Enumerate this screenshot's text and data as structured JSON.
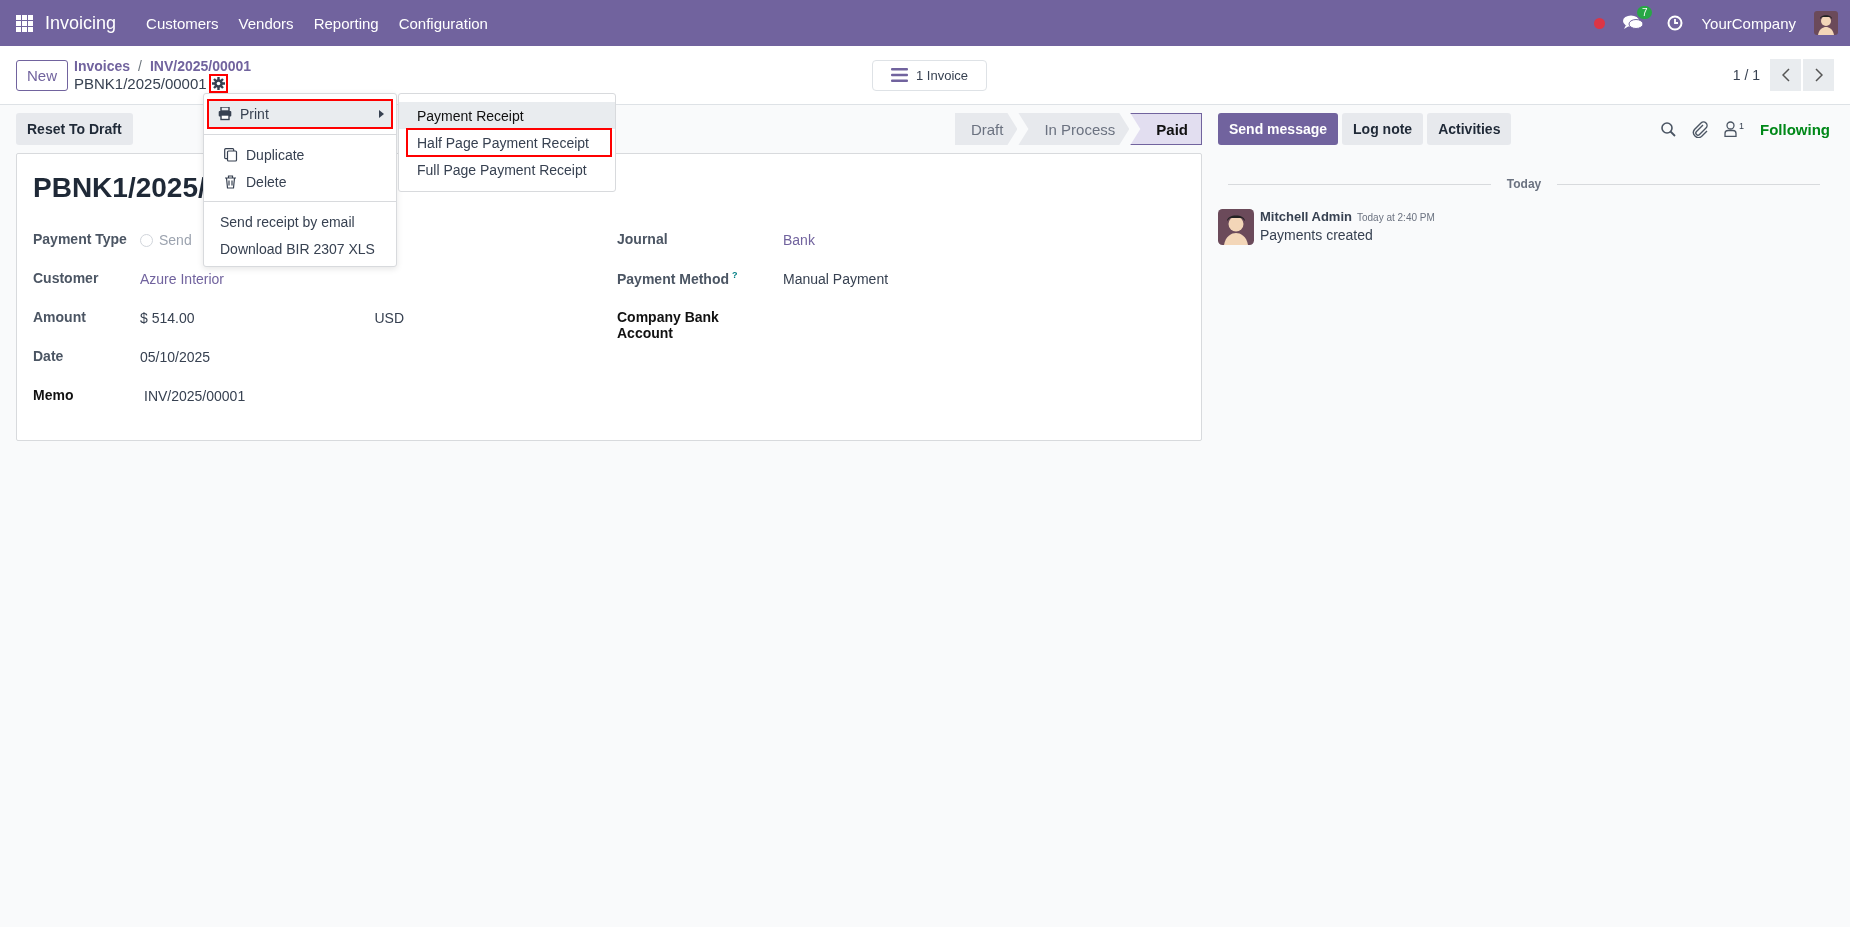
{
  "navbar": {
    "app": "Invoicing",
    "menus": [
      "Customers",
      "Vendors",
      "Reporting",
      "Configuration"
    ],
    "messages_count": "7",
    "company": "YourCompany"
  },
  "breadcrumbs": {
    "new_button": "New",
    "separator": "/",
    "path": [
      "Invoices",
      "INV/2025/00001"
    ],
    "record": "PBNK1/2025/00001",
    "gear_highlighted": true
  },
  "smart_button": "1 Invoice",
  "pager": "1 / 1",
  "actions": [
    "Reset To Draft"
  ],
  "statusbar": [
    {
      "label": "Draft",
      "selected": false
    },
    {
      "label": "In Process",
      "selected": false
    },
    {
      "label": "Paid",
      "selected": true
    }
  ],
  "form": {
    "title": "PBNK1/2025/",
    "left": [
      {
        "label": "Payment Type",
        "kind": "radio",
        "value": "Send",
        "checked": false,
        "required": false
      },
      {
        "label": "Customer",
        "kind": "link",
        "value": "Azure Interior",
        "required": false
      },
      {
        "label": "Amount",
        "kind": "currency",
        "value": "$ 514.00",
        "currency": "USD",
        "required": false
      },
      {
        "label": "Date",
        "kind": "text",
        "value": "05/10/2025",
        "required": false
      },
      {
        "label": "Memo",
        "kind": "text",
        "value": "INV/2025/00001",
        "required": true
      }
    ],
    "right": [
      {
        "label": "Journal",
        "kind": "link",
        "value": "Bank",
        "required": false
      },
      {
        "label": "Payment Method",
        "kind": "text",
        "value": "Manual Payment",
        "help": "?",
        "required": false
      },
      {
        "label": "Company Bank Account",
        "kind": "empty",
        "required": true
      }
    ]
  },
  "action_menu": {
    "groups": [
      [
        {
          "kind": "print",
          "label": "Print",
          "highlighted": true
        }
      ],
      [
        {
          "kind": "duplicate",
          "label": "Duplicate",
          "highlighted": false
        },
        {
          "kind": "delete",
          "label": "Delete",
          "highlighted": false
        }
      ],
      [
        {
          "kind": "plain",
          "label": "Send receipt by email",
          "highlighted": false
        },
        {
          "kind": "plain",
          "label": "Download BIR 2307 XLS",
          "highlighted": false
        }
      ]
    ],
    "submenu": [
      {
        "label": "Payment Receipt",
        "selected": true,
        "highlighted": false
      },
      {
        "label": "Half Page Payment Receipt",
        "selected": false,
        "highlighted": true
      },
      {
        "label": "Full Page Payment Receipt",
        "selected": false,
        "highlighted": false
      }
    ]
  },
  "chatter": {
    "buttons": [
      {
        "label": "Send message",
        "selected": true
      },
      {
        "label": "Log note",
        "selected": false
      },
      {
        "label": "Activities",
        "selected": false
      }
    ],
    "followers_count": "1",
    "follow_status": "Following",
    "date_separator": "Today",
    "messages": [
      {
        "author": "Mitchell Admin",
        "time": "Today at 2:40 PM",
        "body": "Payments created"
      }
    ]
  }
}
